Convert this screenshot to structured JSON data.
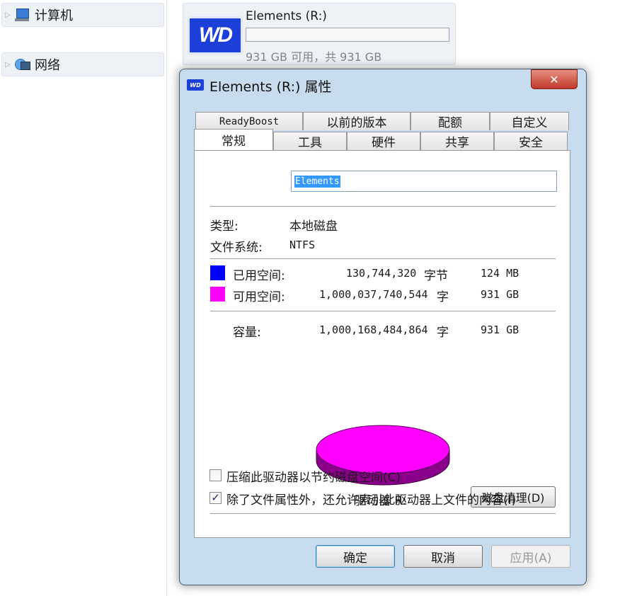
{
  "nav": {
    "computer_label": "计算机",
    "network_label": "网络"
  },
  "drive_tile": {
    "logo_text": "WD",
    "name": "Elements (R:)",
    "used_fraction": 0.0,
    "free_text": "931 GB 可用，共 931 GB"
  },
  "dialog": {
    "title": "Elements (R:) 属性",
    "close_symbol": "✕",
    "tabs_row1": [
      "ReadyBoost",
      "以前的版本",
      "配额",
      "自定义"
    ],
    "tabs_row2": [
      "常规",
      "工具",
      "硬件",
      "共享",
      "安全"
    ],
    "active_tab": "常规",
    "volume_name": "Elements",
    "type_label": "类型:",
    "type_value": "本地磁盘",
    "fs_label": "文件系统:",
    "fs_value": "NTFS",
    "used_label": "已用空间:",
    "used_bytes": "130,744,320",
    "used_unit": "字节",
    "used_size": "124 MB",
    "free_label": "可用空间:",
    "free_bytes": "1,000,037,740,544",
    "free_unit": "字",
    "free_size": "931 GB",
    "cap_label": "容量:",
    "cap_bytes": "1,000,168,484,864",
    "cap_unit": "字",
    "cap_size": "931 GB",
    "drive_label": "驱动器 R:",
    "cleanup_button": "磁盘清理(D)",
    "compress_label": "压缩此驱动器以节约磁盘空间(C)",
    "compress_checked": false,
    "index_label": "除了文件属性外，还允许索引此驱动器上文件的内容(I)",
    "index_checked": true,
    "ok_button": "确定",
    "cancel_button": "取消",
    "apply_button": "应用(A)"
  },
  "colors": {
    "used": "#0000ff",
    "free": "#ff00ff",
    "free_shadow": "#8a008a"
  },
  "chart_data": {
    "type": "pie",
    "categories": [
      "已用空间",
      "可用空间"
    ],
    "values": [
      130744320,
      1000037740544
    ]
  }
}
